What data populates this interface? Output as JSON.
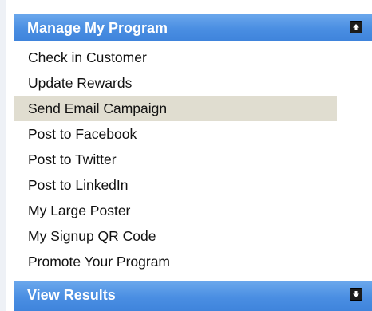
{
  "manage_section": {
    "title": "Manage My Program",
    "toggle_icon": "arrow-up-icon",
    "items": [
      {
        "label": "Check in Customer",
        "highlighted": false
      },
      {
        "label": "Update Rewards",
        "highlighted": false
      },
      {
        "label": "Send Email Campaign",
        "highlighted": true
      },
      {
        "label": "Post to Facebook",
        "highlighted": false
      },
      {
        "label": "Post to Twitter",
        "highlighted": false
      },
      {
        "label": "Post to LinkedIn",
        "highlighted": false
      },
      {
        "label": "My Large Poster",
        "highlighted": false
      },
      {
        "label": "My Signup QR Code",
        "highlighted": false
      },
      {
        "label": "Promote Your Program",
        "highlighted": false
      }
    ]
  },
  "results_section": {
    "title": "View Results",
    "toggle_icon": "arrow-down-icon"
  },
  "colors": {
    "header_blue": "#4a8ee2",
    "highlight": "#e0ddd0",
    "text": "#111111"
  }
}
